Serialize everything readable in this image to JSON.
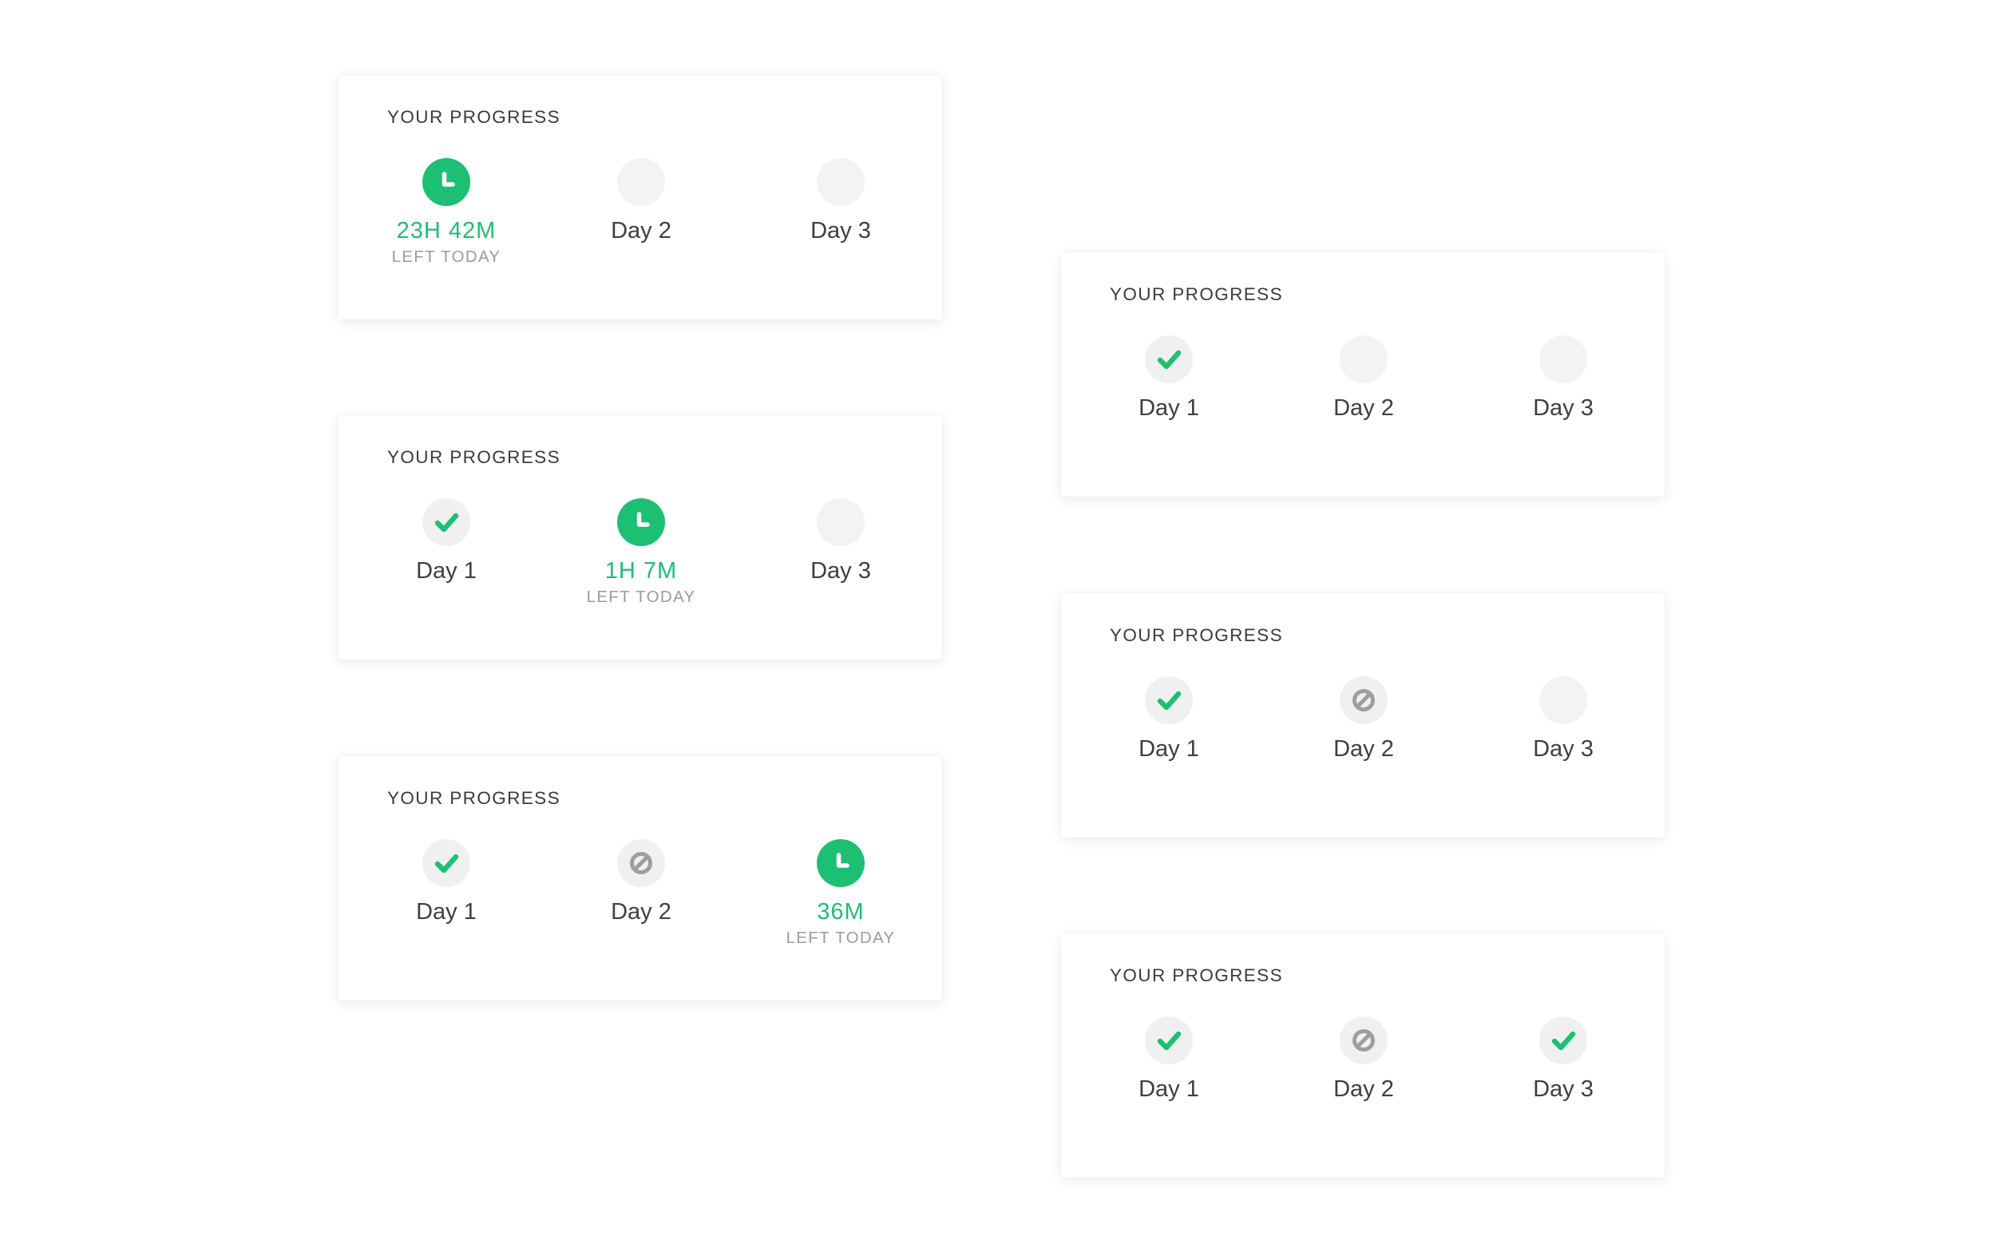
{
  "colors": {
    "accent": "#1dbf73",
    "skipped": "#9e9e9e",
    "empty": "#f3f3f3",
    "text": "#3f3f3f",
    "muted": "#9b9b9b"
  },
  "cards": [
    {
      "title": "YOUR PROGRESS",
      "days": [
        {
          "state": "clock-icon",
          "label": "23H 42M",
          "sub": "LEFT TODAY"
        },
        {
          "state": "empty",
          "label": "Day 2",
          "sub": ""
        },
        {
          "state": "empty",
          "label": "Day 3",
          "sub": ""
        }
      ]
    },
    {
      "title": "YOUR PROGRESS",
      "days": [
        {
          "state": "check-icon",
          "label": "Day 1",
          "sub": ""
        },
        {
          "state": "clock-icon",
          "label": "1H 7M",
          "sub": "LEFT TODAY"
        },
        {
          "state": "empty",
          "label": "Day 3",
          "sub": ""
        }
      ]
    },
    {
      "title": "YOUR PROGRESS",
      "days": [
        {
          "state": "check-icon",
          "label": "Day 1",
          "sub": ""
        },
        {
          "state": "skipped-icon",
          "label": "Day 2",
          "sub": ""
        },
        {
          "state": "clock-icon",
          "label": "36M",
          "sub": "LEFT TODAY"
        }
      ]
    },
    {
      "title": "YOUR PROGRESS",
      "days": [
        {
          "state": "check-icon",
          "label": "Day 1",
          "sub": ""
        },
        {
          "state": "empty",
          "label": "Day 2",
          "sub": ""
        },
        {
          "state": "empty",
          "label": "Day 3",
          "sub": ""
        }
      ]
    },
    {
      "title": "YOUR PROGRESS",
      "days": [
        {
          "state": "check-icon",
          "label": "Day 1",
          "sub": ""
        },
        {
          "state": "skipped-icon",
          "label": "Day 2",
          "sub": ""
        },
        {
          "state": "empty",
          "label": "Day 3",
          "sub": ""
        }
      ]
    },
    {
      "title": "YOUR PROGRESS",
      "days": [
        {
          "state": "check-icon",
          "label": "Day 1",
          "sub": ""
        },
        {
          "state": "skipped-icon",
          "label": "Day 2",
          "sub": ""
        },
        {
          "state": "check-icon",
          "label": "Day 3",
          "sub": ""
        }
      ]
    }
  ]
}
